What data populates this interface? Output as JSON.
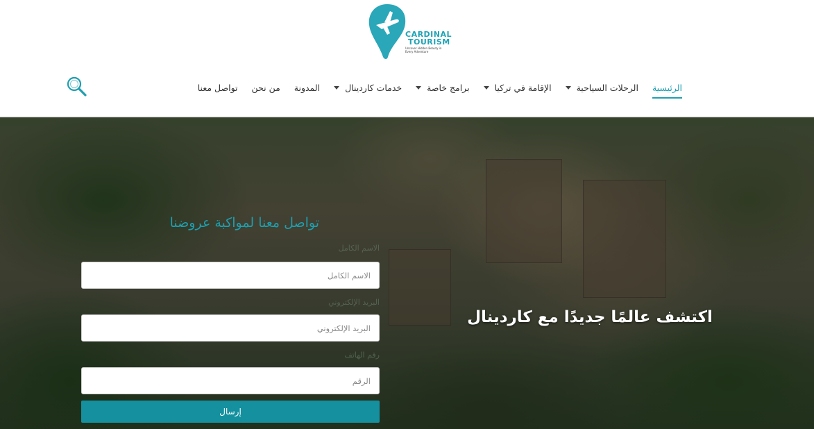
{
  "brand": {
    "name_line1": "CARDINAL",
    "name_line2": "TOURISM",
    "tagline": "Uncover Hidden Beauty in Every Adventure",
    "accent_color": "#1e9fb0",
    "logo_icon": "plane-pin-icon"
  },
  "nav": {
    "items": [
      {
        "label": "الرئيسية",
        "active": true,
        "has_dropdown": false
      },
      {
        "label": "الرحلات السياحية",
        "active": false,
        "has_dropdown": true
      },
      {
        "label": "الإقامة في تركيا",
        "active": false,
        "has_dropdown": true
      },
      {
        "label": "برامج خاصة",
        "active": false,
        "has_dropdown": true
      },
      {
        "label": "خدمات كاردينال",
        "active": false,
        "has_dropdown": true
      },
      {
        "label": "المدونة",
        "active": false,
        "has_dropdown": false
      },
      {
        "label": "من نحن",
        "active": false,
        "has_dropdown": false
      },
      {
        "label": "تواصل معنا",
        "active": false,
        "has_dropdown": false
      }
    ],
    "search_icon": "search-icon"
  },
  "hero": {
    "headline": "اكتشف عالمًا جديدًا مع كاردينال"
  },
  "form": {
    "title": "تواصل معنا لمواكبة عروضنا",
    "name_label": "الاسم الكامل",
    "name_placeholder": "الاسم الكامل",
    "email_label": "البريد الإلكتروني",
    "email_placeholder": "البريد الإلكتروني",
    "phone_label": "رقم الهاتف",
    "phone_placeholder": "الرقم",
    "submit_label": "إرسال",
    "submit_color": "#14909e"
  }
}
